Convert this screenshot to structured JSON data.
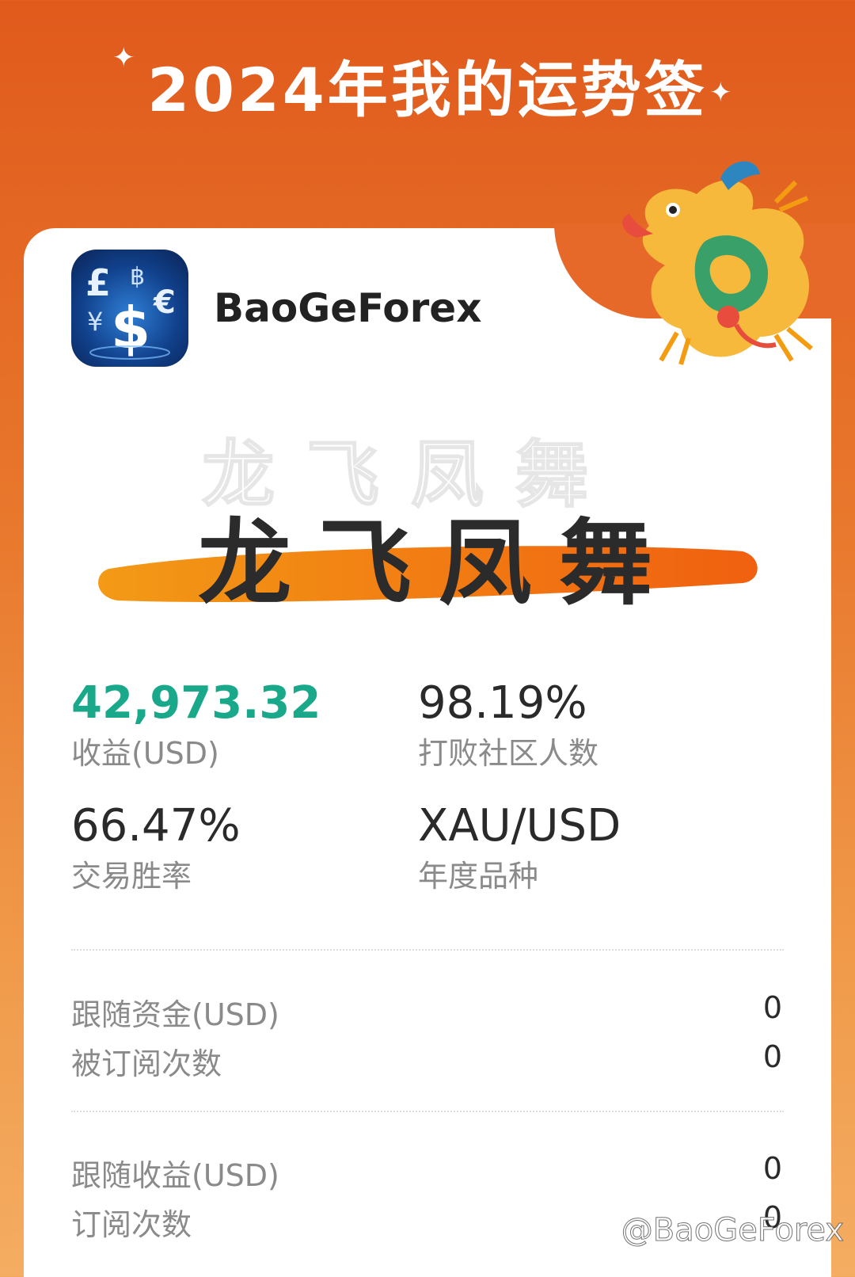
{
  "header": {
    "title": "2024年我的运势签"
  },
  "profile": {
    "name": "BaoGeForex"
  },
  "fortune": {
    "slogan": "龙飞凤舞"
  },
  "stats": {
    "profit": {
      "value": "42,973.32",
      "label": "收益(USD)"
    },
    "beat_rate": {
      "value": "98.19%",
      "label": "打败社区人数"
    },
    "win_rate": {
      "value": "66.47%",
      "label": "交易胜率"
    },
    "symbol": {
      "value": "XAU/USD",
      "label": "年度品种"
    }
  },
  "follow_section": [
    {
      "label": "跟随资金(USD)",
      "value": "0"
    },
    {
      "label": "被订阅次数",
      "value": "0"
    }
  ],
  "follow_profit_section": [
    {
      "label": "跟随收益(USD)",
      "value": "0"
    },
    {
      "label": "订阅次数",
      "value": "0"
    }
  ],
  "watermark": "@BaoGeForex",
  "colors": {
    "accent_orange": "#e05a1c",
    "profit_green": "#19a98a"
  }
}
